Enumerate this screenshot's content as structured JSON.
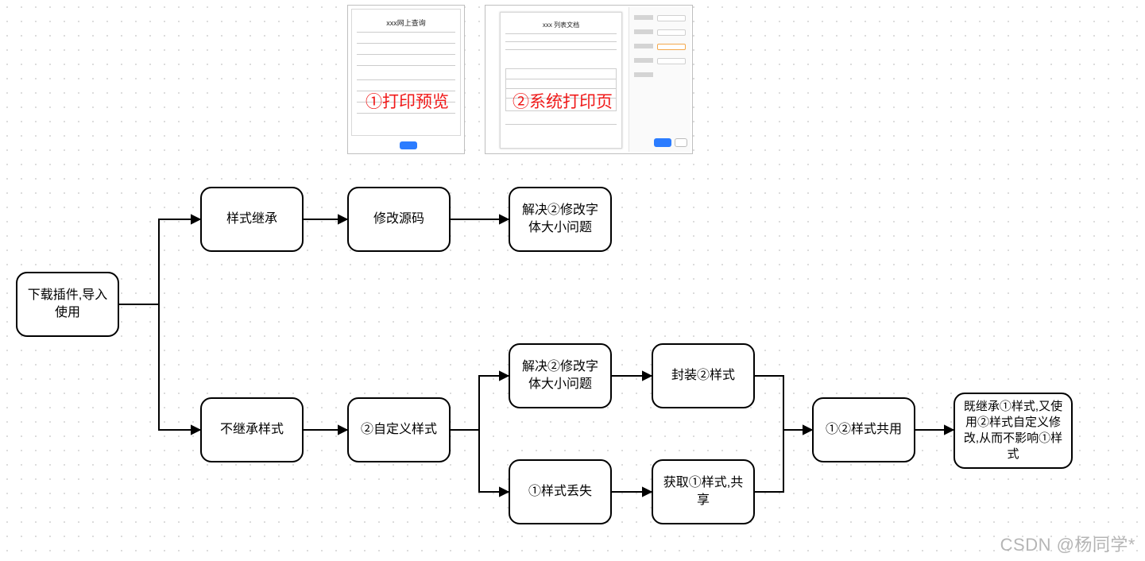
{
  "screenshots": {
    "preview": {
      "label": "①打印预览",
      "header": "xxx网上查询"
    },
    "systemPrint": {
      "label": "②系统打印页",
      "header": "xxx 列表文档"
    }
  },
  "nodes": {
    "start": "下载插件,导入使用",
    "inheritStyle": "样式继承",
    "modifySource": "修改源码",
    "solveFont1": "解决②修改字体大小问题",
    "noInherit": "不继承样式",
    "customStyle": "②自定义样式",
    "solveFont2": "解决②修改字体大小问题",
    "styleLost": "①样式丢失",
    "wrapStyle": "封装②样式",
    "getShare": "获取①样式,共享",
    "bothStyle": "①②样式共用",
    "final": "既继承①样式,又使用②样式自定义修改,从而不影响①样式"
  },
  "watermark": "CSDN @杨同学*"
}
